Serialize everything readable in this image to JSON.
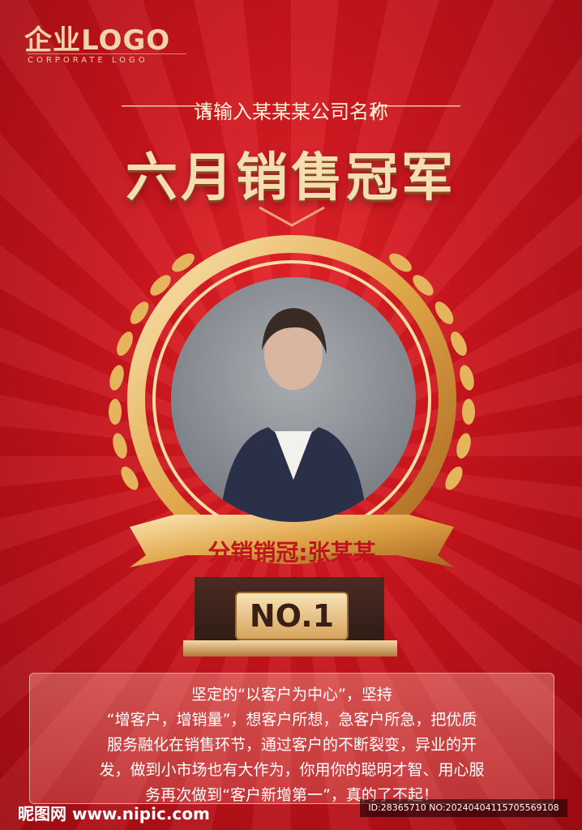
{
  "logo": {
    "main": "企业LOGO",
    "sub": "CORPORATE LOGO"
  },
  "company_name": "请输入某某某公司名称",
  "title": "六月销售冠军",
  "banner_label": "分销销冠:张某某",
  "badge": "NO.1",
  "description": [
    "坚定的“以客户为中心”，坚持",
    "“增客户，增销量”，想客户所想，急客户所急，把优质",
    "服务融化在销售环节，通过客户的不断裂变，异业的开",
    "发，做到小市场也有大作为，你用你的聪明才智、用心服",
    "务再次做到“客户新增第一”，真的了不起！"
  ],
  "watermark": {
    "left": "昵图网 www.nipic.com",
    "right": "ID:28365710 NO:20240404115705569108"
  },
  "colors": {
    "accent": "#c8141c",
    "gold": "#e2b565"
  }
}
